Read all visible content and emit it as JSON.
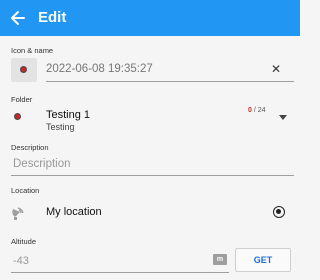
{
  "appbar": {
    "title": "Edit",
    "back_icon": "arrow-back-icon"
  },
  "icon_name": {
    "label": "Icon & name",
    "value": "2022-06-08 19:35:27",
    "clear_glyph": "✕",
    "icon_color": "#c62828"
  },
  "folder": {
    "label": "Folder",
    "name": "Testing 1",
    "subtitle": "Testing",
    "count_current": "0",
    "count_total": " / 24"
  },
  "description": {
    "label": "Description",
    "placeholder": "Description"
  },
  "location": {
    "label": "Location",
    "value": "My location",
    "selected": true
  },
  "altitude": {
    "label": "Altitude",
    "value": "-43",
    "unit": "m",
    "get_label": "GET"
  },
  "colors": {
    "appbar": "#2196f3",
    "accent_red": "#c62828",
    "button_text": "#1e6fd1"
  }
}
